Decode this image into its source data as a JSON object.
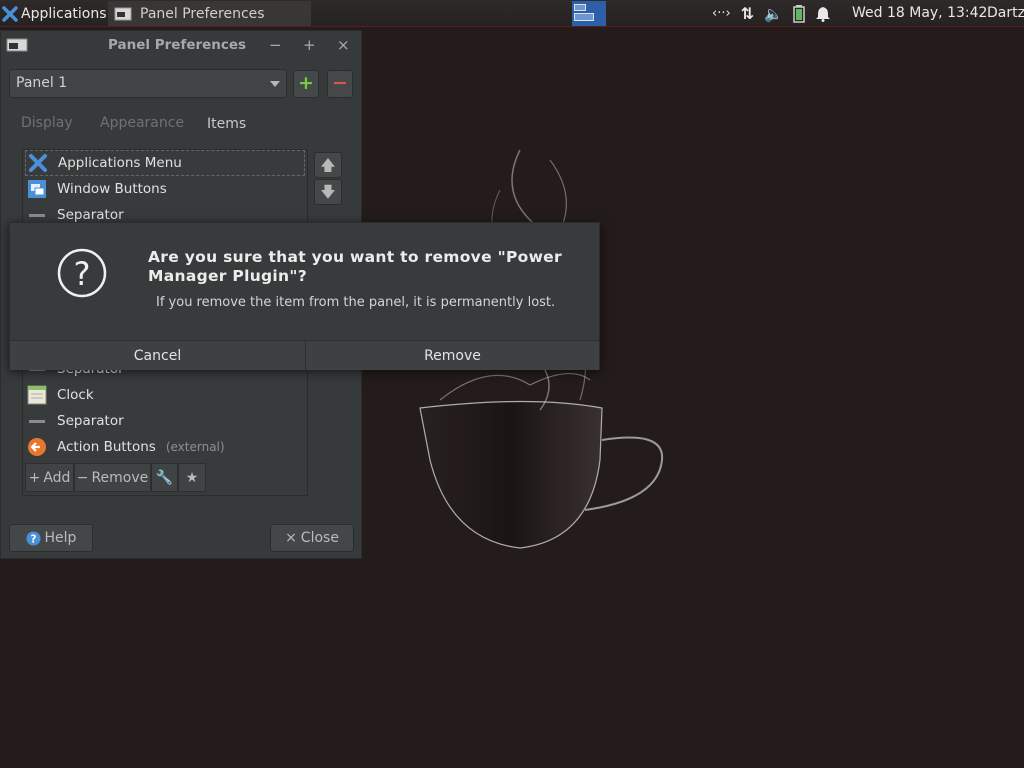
{
  "top_panel": {
    "apps_label": "Applications",
    "task_title": "Panel Preferences",
    "clock": "Wed 18 May, 13:42",
    "user": "Dartz"
  },
  "prefs": {
    "title": "Panel Preferences",
    "panel_selected": "Panel 1",
    "add_symbol": "+",
    "remove_symbol": "−",
    "tabs": [
      "Display",
      "Appearance",
      "Items"
    ],
    "active_tab": "Items",
    "items": [
      {
        "label": "Applications Menu",
        "icon": "applications-menu-icon"
      },
      {
        "label": "Window Buttons",
        "icon": "window-buttons-icon"
      },
      {
        "label": "Separator",
        "icon": "separator-icon"
      },
      {
        "label": "Separator",
        "icon": "separator-icon"
      },
      {
        "label": "Clock",
        "icon": "clock-icon"
      },
      {
        "label": "Separator",
        "icon": "separator-icon"
      },
      {
        "label": "Action Buttons",
        "icon": "action-buttons-icon",
        "suffix": "(external)"
      }
    ],
    "toolbar": {
      "add": "Add",
      "remove": "Remove"
    },
    "help": "Help",
    "close": "Close"
  },
  "dialog": {
    "title": "Are you sure that you want to remove \"Power Manager Plugin\"?",
    "message": "If you remove the item from the panel, it is permanently lost.",
    "cancel": "Cancel",
    "remove": "Remove"
  },
  "colors": {
    "accent": "#2c5fa6",
    "panel_border": "#5a1e22",
    "add_green": "#7ac943",
    "remove_red": "#d9534f"
  }
}
